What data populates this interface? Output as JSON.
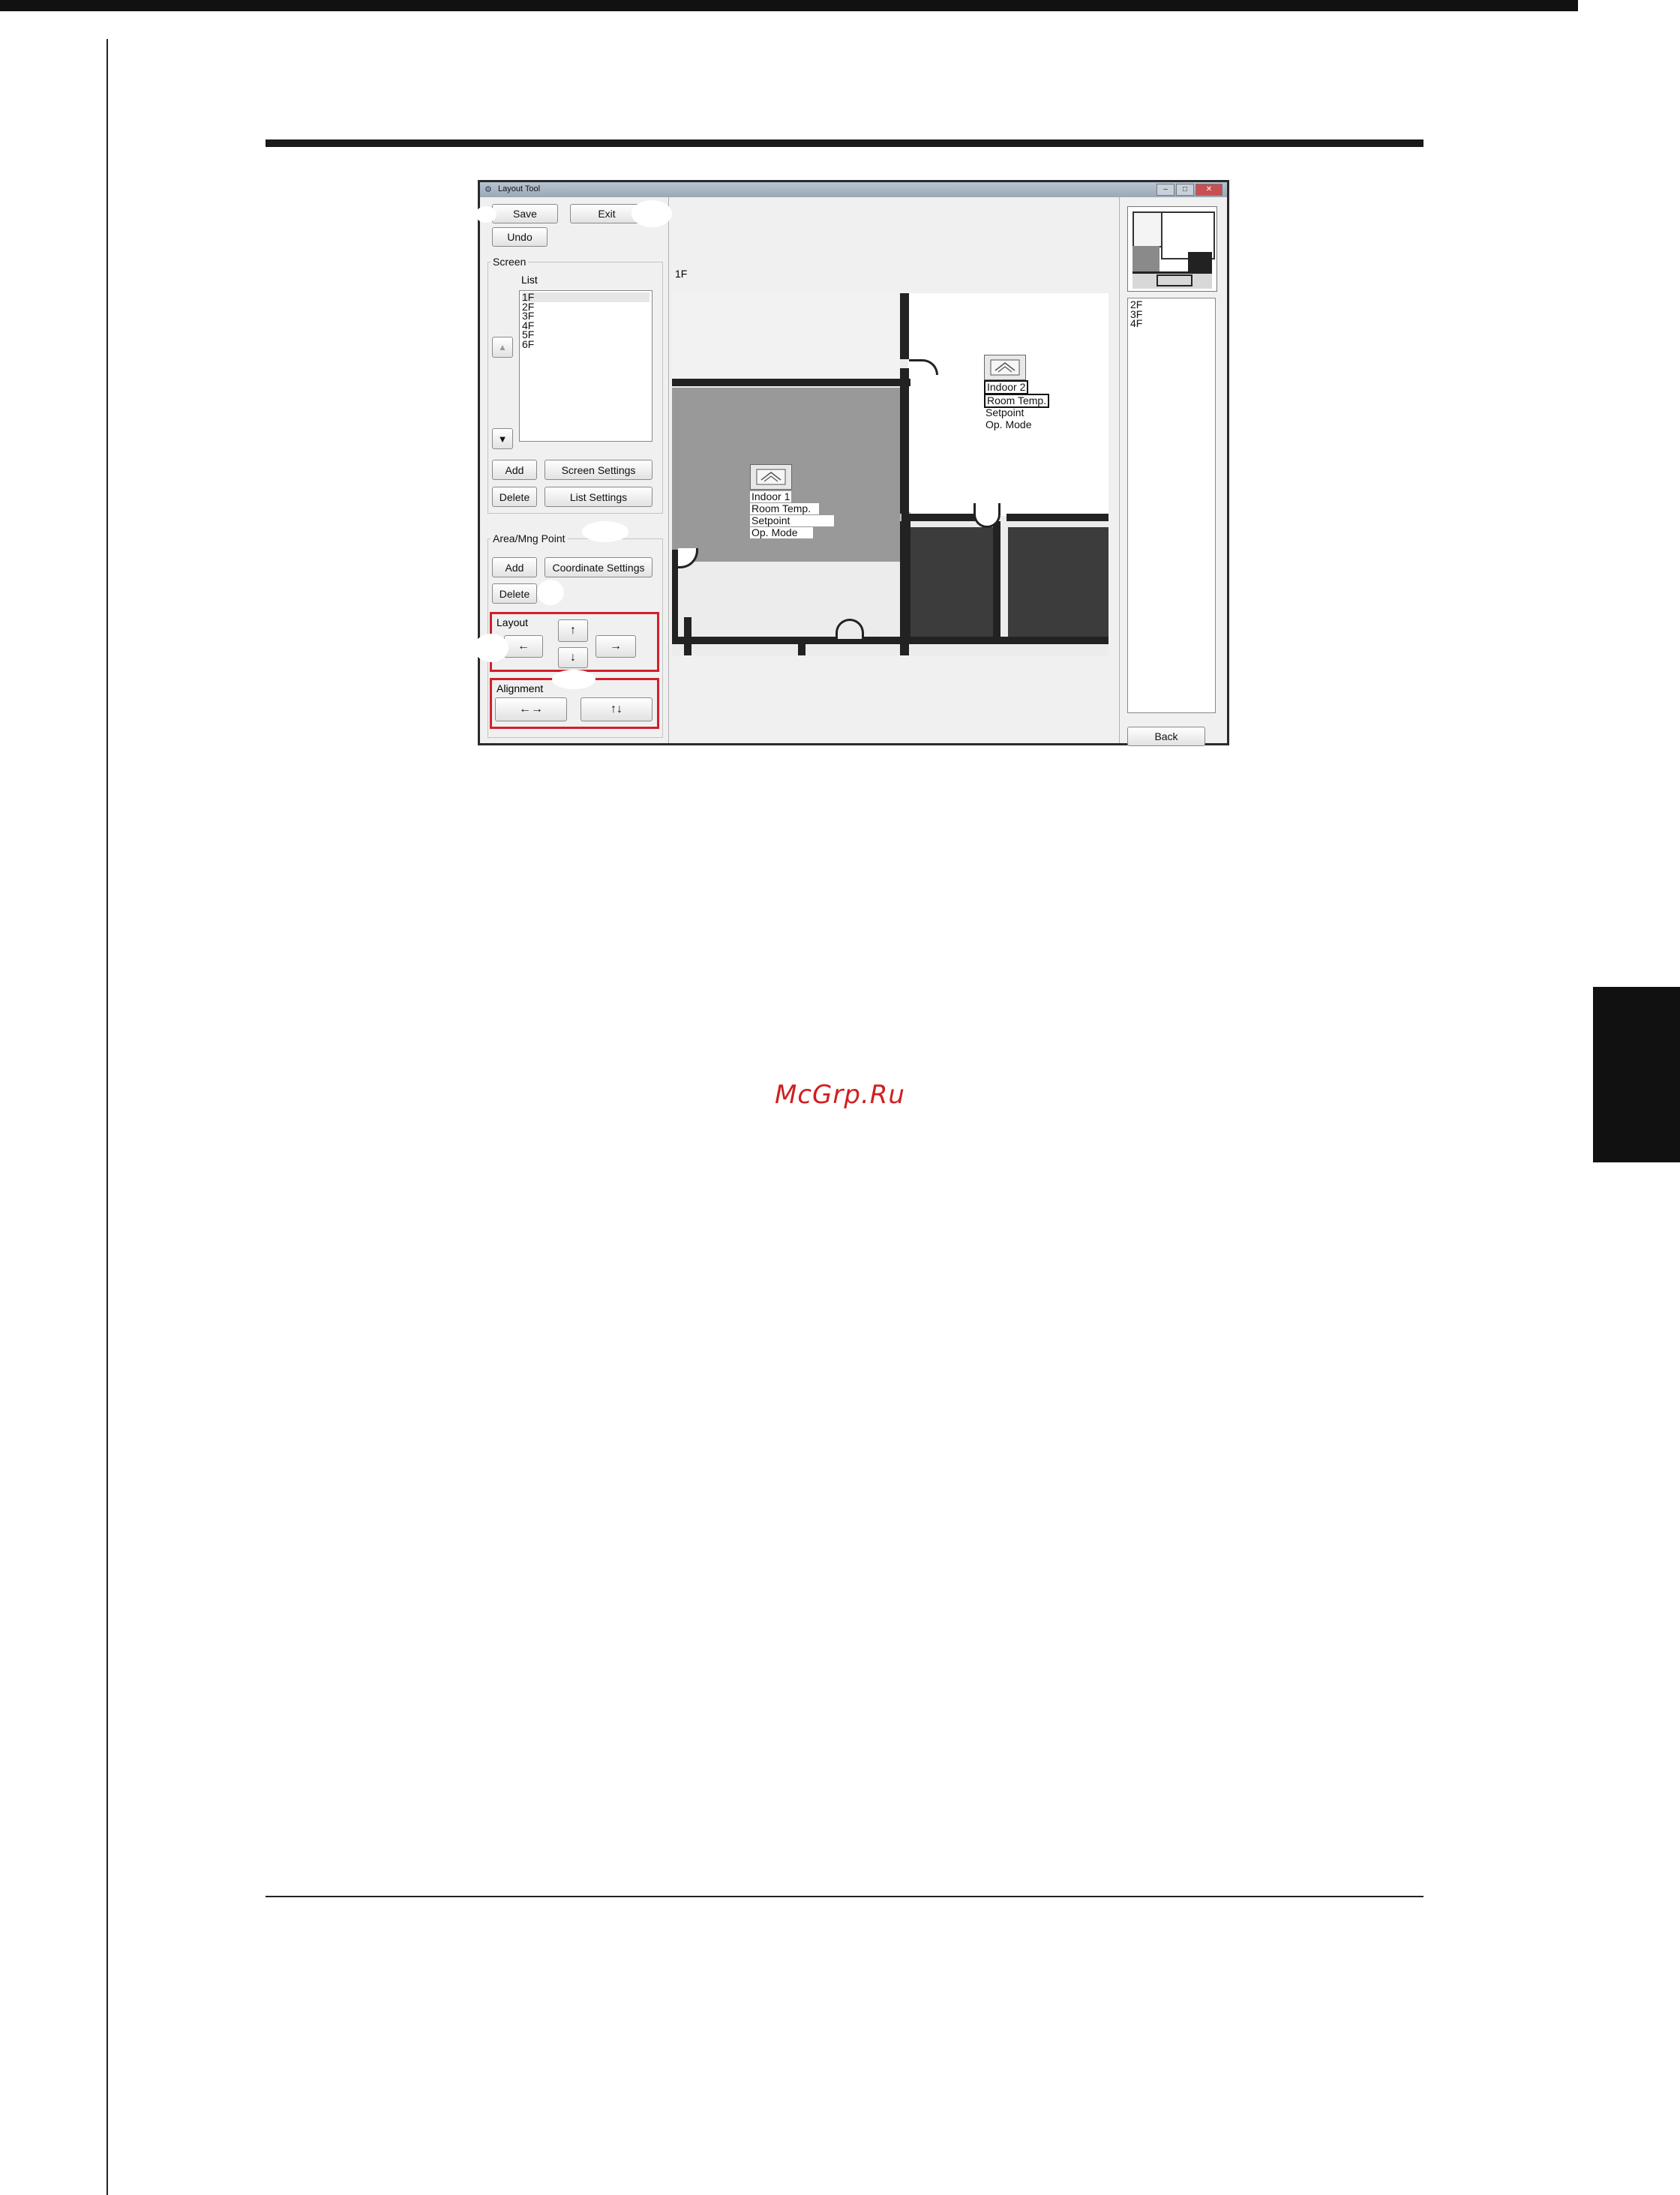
{
  "page": {
    "watermark": "McGrp.Ru"
  },
  "window": {
    "title": "Layout Tool",
    "controls": {
      "minimize": "–",
      "maximize": "□",
      "close": "✕"
    }
  },
  "toolbar": {
    "save_label": "Save",
    "exit_label": "Exit",
    "undo_label": "Undo"
  },
  "screen_group": {
    "label": "Screen",
    "list_label": "List",
    "items": [
      "1F",
      "2F",
      "3F",
      "4F",
      "5F",
      "6F"
    ],
    "selected": "1F",
    "move_up_glyph": "▲",
    "move_down_glyph": "▼",
    "add_label": "Add",
    "delete_label": "Delete",
    "screen_settings_label": "Screen Settings",
    "list_settings_label": "List Settings"
  },
  "area_group": {
    "label": "Area/Mng Point",
    "add_label": "Add",
    "delete_label": "Delete",
    "coordinate_settings_label": "Coordinate Settings"
  },
  "layout_group": {
    "label": "Layout",
    "left": "←",
    "up": "↑",
    "down": "↓",
    "right": "→"
  },
  "alignment_group": {
    "label": "Alignment",
    "horizontal": "←→",
    "vertical": "↑↓"
  },
  "canvas": {
    "floor_label": "1F",
    "units": [
      {
        "name": "Indoor 1",
        "room_temp": "Room Temp.",
        "setpoint": "Setpoint",
        "op_mode": "Op. Mode"
      },
      {
        "name": "Indoor 2",
        "room_temp": "Room Temp.",
        "setpoint": "Setpoint",
        "op_mode": "Op. Mode"
      }
    ]
  },
  "right_panel": {
    "list_items": [
      "2F",
      "3F",
      "4F"
    ],
    "back_label": "Back"
  },
  "colors": {
    "highlight_box": "#d0202a",
    "room_gray": "#999999",
    "room_dark": "#3c3c3c"
  }
}
